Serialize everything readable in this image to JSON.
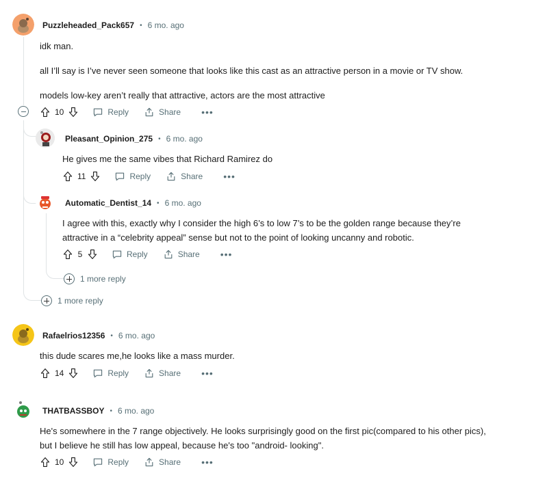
{
  "comments": [
    {
      "username": "Puzzleheaded_Pack657",
      "time": "6 mo. ago",
      "lines": [
        "idk man.",
        "all I’ll say is I’ve never seen someone that looks like this cast as an attractive person in a movie or TV show.",
        "models low-key aren’t really that attractive, actors are the most attractive"
      ],
      "votes": "10",
      "more_replies": "1 more reply",
      "replies": [
        {
          "username": "Pleasant_Opinion_275",
          "time": "6 mo. ago",
          "lines": [
            "He gives me the same vibes that Richard Ramirez do"
          ],
          "votes": "11"
        },
        {
          "username": "Automatic_Dentist_14",
          "time": "6 mo. ago",
          "lines": [
            "I agree with this, exactly why I consider the high 6’s to low 7’s to be the golden range because they’re",
            "attractive in a “celebrity appeal” sense but not to the point of looking uncanny and robotic."
          ],
          "votes": "5",
          "more_replies": "1 more reply"
        }
      ]
    },
    {
      "username": "Rafaelrios12356",
      "time": "6 mo. ago",
      "lines": [
        "this dude scares me,he looks like a mass murder."
      ],
      "votes": "14"
    },
    {
      "username": "THATBASSBOY",
      "time": "6 mo. ago",
      "lines": [
        "He's somewhere in the 7 range objectively. He looks surprisingly good on the first pic(compared to his other pics),",
        "but I believe he still has low appeal, because he's too \"android- looking\"."
      ],
      "votes": "10"
    }
  ],
  "labels": {
    "reply": "Reply",
    "share": "Share",
    "more": "•••"
  },
  "colors": {
    "avatar_orange": "#f4a06b",
    "avatar_yellow": "#f5c518",
    "meta_gray": "#576f76",
    "thread_line": "#dfe3e5"
  }
}
